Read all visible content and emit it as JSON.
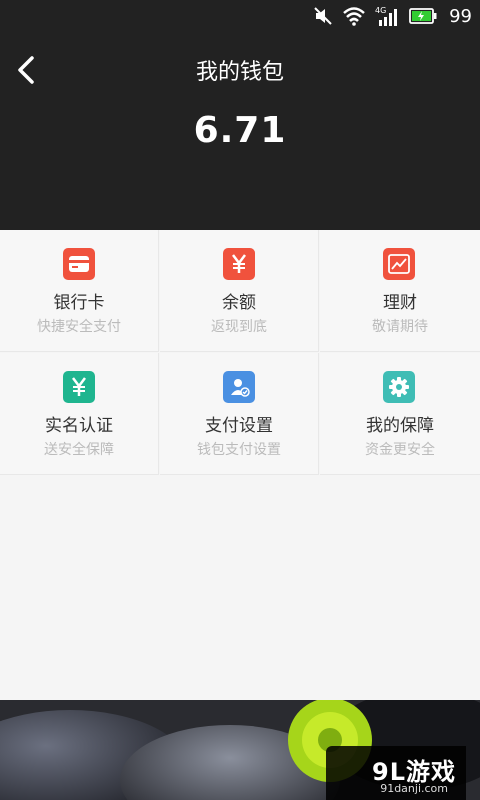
{
  "status_bar": {
    "battery_level": "99",
    "network": "4G"
  },
  "header": {
    "title": "我的钱包",
    "balance": "6.71"
  },
  "menu": [
    {
      "label": "银行卡",
      "sub": "快捷安全支付",
      "icon": "bank-card-icon",
      "color": "#f0523d"
    },
    {
      "label": "余额",
      "sub": "返现到底",
      "icon": "yuan-icon",
      "color": "#f0523d"
    },
    {
      "label": "理财",
      "sub": "敬请期待",
      "icon": "chart-icon",
      "color": "#f0523d"
    },
    {
      "label": "实名认证",
      "sub": "送安全保障",
      "icon": "yuan-icon",
      "color": "#1fb58f"
    },
    {
      "label": "支付设置",
      "sub": "钱包支付设置",
      "icon": "user-check-icon",
      "color": "#4a90e2"
    },
    {
      "label": "我的保障",
      "sub": "资金更安全",
      "icon": "gear-icon",
      "color": "#3fbdb5"
    }
  ],
  "watermark": {
    "main": "9L游戏",
    "sub": "91danji.com"
  }
}
